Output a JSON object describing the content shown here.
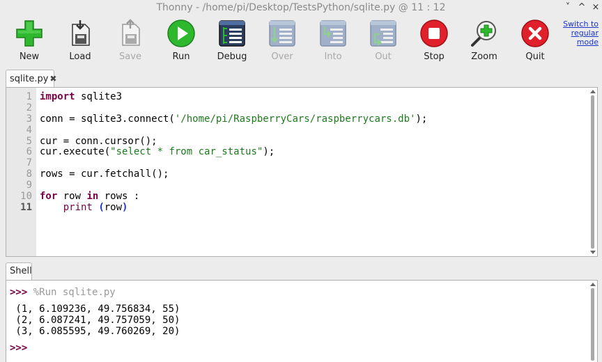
{
  "window": {
    "title": "Thonny  -  /home/pi/Desktop/TestsPython/sqlite.py  @  11 : 12",
    "controls": [
      "˅",
      "^",
      "×"
    ]
  },
  "toolbar": {
    "new_label": "New",
    "load_label": "Load",
    "save_label": "Save",
    "run_label": "Run",
    "debug_label": "Debug",
    "over_label": "Over",
    "into_label": "Into",
    "out_label": "Out",
    "stop_label": "Stop",
    "zoom_label": "Zoom",
    "quit_label": "Quit",
    "mode_link": [
      "Switch to",
      "regular",
      "mode"
    ]
  },
  "editor": {
    "tab_label": "sqlite.py",
    "tab_close": "✖",
    "line_numbers": [
      "1",
      "2",
      "3",
      "4",
      "5",
      "6",
      "7",
      "8",
      "9",
      "10",
      "11"
    ],
    "lines": {
      "l1_kw": "import",
      "l1_rest": " sqlite3",
      "l3_a": "conn = sqlite3.connect(",
      "l3_str": "'/home/pi/RaspberryCars/raspberrycars.db'",
      "l3_b": ");",
      "l5": "cur = conn.cursor();",
      "l6_a": "cur.execute(",
      "l6_str": "\"select * from car_status\"",
      "l6_b": ");",
      "l8": "rows = cur.fetchall();",
      "l10_kw1": "for",
      "l10_mid": " row ",
      "l10_kw2": "in",
      "l10_rest": " rows :",
      "l11_indent": "    ",
      "l11_bi": "print",
      "l11_sp": " ",
      "l11_open": "(",
      "l11_arg": "row",
      "l11_close": ")"
    }
  },
  "shell": {
    "tab_label": "Shell",
    "prompt": ">>>",
    "run_command": " %Run sqlite.py",
    "output": [
      " (1, 6.109236, 49.756834, 55)",
      " (2, 6.087241, 49.757059, 50)",
      " (3, 6.085595, 49.760269, 20)"
    ]
  },
  "colors": {
    "keyword": "#7a0046",
    "string": "#1d7a1d",
    "run_green": "#2eb82e",
    "stop_red": "#e0202b",
    "link_blue": "#1a33c8"
  },
  "icons": {
    "new": "plus-icon",
    "load": "load-icon",
    "save": "save-icon",
    "run": "play-icon",
    "debug": "debug-icon",
    "over": "step-over-icon",
    "into": "step-into-icon",
    "out": "step-out-icon",
    "stop": "stop-icon",
    "zoom": "zoom-icon",
    "quit": "quit-icon"
  }
}
